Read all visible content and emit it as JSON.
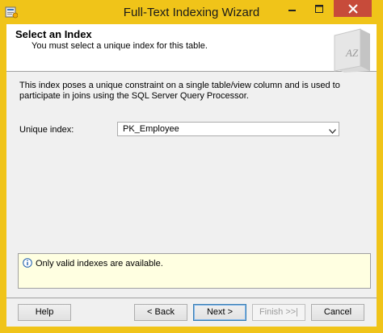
{
  "window": {
    "title": "Full-Text Indexing Wizard"
  },
  "header": {
    "title": "Select an Index",
    "subtitle": "You must select a unique index for this table."
  },
  "body": {
    "description": "This index poses a unique constraint on a single table/view column and is used to participate in joins using the SQL Server Query Processor.",
    "unique_index_label": "Unique index:",
    "unique_index_value": "PK_Employee"
  },
  "message": {
    "text": "Only valid indexes are available."
  },
  "buttons": {
    "help": "Help",
    "back": "< Back",
    "next": "Next >",
    "finish": "Finish >>|",
    "cancel": "Cancel"
  },
  "icons": {
    "app": "wizard-app-icon",
    "header": "book-az-icon",
    "info": "info-icon",
    "minimize": "minimize-icon",
    "maximize": "maximize-icon",
    "close": "close-icon",
    "dropdown": "chevron-down-icon"
  },
  "colors": {
    "frame": "#f0c419",
    "close_button": "#c74b3a",
    "message_background": "#ffffe1",
    "default_button_border": "#3c7fb1"
  }
}
